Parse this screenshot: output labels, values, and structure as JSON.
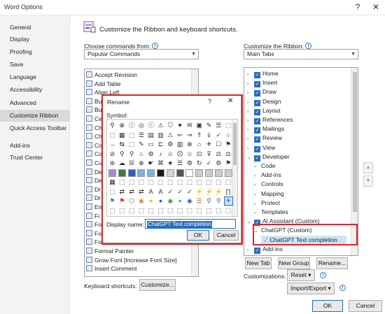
{
  "window": {
    "title": "Word Options",
    "help": "?",
    "close": "✕"
  },
  "nav": {
    "items": [
      {
        "label": "General"
      },
      {
        "label": "Display"
      },
      {
        "label": "Proofing"
      },
      {
        "label": "Save"
      },
      {
        "label": "Language"
      },
      {
        "label": "Accessibility"
      },
      {
        "label": "Advanced"
      },
      {
        "label": "Customize Ribbon"
      },
      {
        "label": "Quick Access Toolbar"
      },
      {
        "label": "Add-ins"
      },
      {
        "label": "Trust Center"
      }
    ],
    "active_index": 7
  },
  "main": {
    "header": "Customize the Ribbon and keyboard shortcuts.",
    "choose_label": "Choose commands from:",
    "choose_value": "Popular Commands",
    "customize_label": "Customize the Ribbon:",
    "customize_value": "Main Tabs",
    "commands": [
      "Accept Revision",
      "Add Table",
      "Align Left",
      "Bu",
      "Bu",
      "Ce",
      "Ch",
      "Ch",
      "Co",
      "Co",
      "Cu",
      "De",
      "De",
      "Dr",
      "Dr",
      "Em",
      "Fi",
      "Fo",
      "Fo",
      "Fo",
      "Format Painter",
      "Grow Font [Increase Font Size]",
      "Insert Comment"
    ],
    "tree": [
      {
        "label": "Home",
        "level": 0,
        "expander": "›",
        "checked": true
      },
      {
        "label": "Insert",
        "level": 0,
        "expander": "›",
        "checked": true
      },
      {
        "label": "Draw",
        "level": 0,
        "expander": "›",
        "checked": true
      },
      {
        "label": "Design",
        "level": 0,
        "expander": "›",
        "checked": true
      },
      {
        "label": "Layout",
        "level": 0,
        "expander": "›",
        "checked": true
      },
      {
        "label": "References",
        "level": 0,
        "expander": "›",
        "checked": true
      },
      {
        "label": "Mailings",
        "level": 0,
        "expander": "›",
        "checked": true
      },
      {
        "label": "Review",
        "level": 0,
        "expander": "›",
        "checked": true
      },
      {
        "label": "View",
        "level": 0,
        "expander": "›",
        "checked": true
      },
      {
        "label": "Developer",
        "level": 0,
        "expander": "⌄",
        "checked": true
      },
      {
        "label": "Code",
        "level": 1,
        "expander": "›",
        "checked": false
      },
      {
        "label": "Add-ins",
        "level": 1,
        "expander": "›",
        "checked": false
      },
      {
        "label": "Controls",
        "level": 1,
        "expander": "›",
        "checked": false
      },
      {
        "label": "Mapping",
        "level": 1,
        "expander": "›",
        "checked": false
      },
      {
        "label": "Protect",
        "level": 1,
        "expander": "›",
        "checked": false
      },
      {
        "label": "Templates",
        "level": 1,
        "expander": "›",
        "checked": false
      },
      {
        "label": "AI Assistant (Custom)",
        "level": 0,
        "expander": "⌄",
        "checked": true
      },
      {
        "label": "ChatGPT (Custom)",
        "level": 1,
        "expander": "⌄",
        "checked": false
      },
      {
        "label": "ChatGPT Text completion",
        "level": 2,
        "expander": "",
        "checked": false
      },
      {
        "label": "Add-ins",
        "level": 0,
        "expander": "›",
        "checked": true
      }
    ],
    "buttons": {
      "new_tab": "New Tab",
      "new_group": "New Group",
      "rename": "Rename...",
      "customizations_label": "Customizations:",
      "reset": "Reset ▾",
      "import_export": "Import/Export ▾",
      "keyboard_label": "Keyboard shortcuts:",
      "customize": "Customize...",
      "ok": "OK",
      "cancel": "Cancel"
    }
  },
  "dialog": {
    "title": "Rename",
    "help": "?",
    "close": "✕",
    "symbol_label": "Symbol:",
    "display_name_label": "Display name:",
    "display_name_value": "ChatGPT Text completion",
    "ok": "OK",
    "cancel": "Cancel",
    "symbols": [
      "⚲",
      "⊗",
      "ⓘ",
      "◎",
      "ⓘ",
      "⚠",
      "⛉",
      "♥",
      "✉",
      "▣",
      "✎",
      "☰",
      "⬚",
      "⬚",
      "▦",
      "⬚",
      "☰",
      "▤",
      "▥",
      "⚠",
      "⇐",
      "⇒",
      "⇑",
      "⇓",
      "✓",
      "○",
      "→",
      "⇆",
      "⬚",
      "✎",
      "▭",
      "⊏",
      "⚙",
      "▥",
      "⊕",
      "⌂",
      "✈",
      "☐",
      "⚑",
      "⊘",
      "⚲",
      "⚲",
      "⌂",
      "⚙",
      "♪",
      "☺",
      "☹",
      "☺",
      "⊡",
      "⊽",
      "⚖",
      "⚖",
      "⊛",
      "☁",
      "☒",
      "⊕",
      "☛",
      "⌘",
      "★",
      "☰",
      "⚙",
      "↻",
      "✓",
      "⚙",
      "⚑",
      "■",
      "■",
      "■",
      "■",
      "■",
      "■",
      "■",
      "■",
      "■",
      "■",
      "■",
      "■",
      "■",
      "▦",
      "⬚",
      "⬚",
      "⬚",
      "⬚",
      "⬚",
      "⬚",
      "⬚",
      "⬚",
      "⬚",
      "⬚",
      "⬚",
      "⬚",
      "⬚",
      "⇄",
      "⇄",
      "⇄",
      "A",
      "A",
      "✓",
      "✓",
      "✓",
      "⚡",
      "⚡",
      "⚡",
      "∏",
      "⚑",
      "⚑",
      "⬡",
      "◉",
      "●",
      "●",
      "◉",
      "●",
      "◉",
      "☰",
      "⚲",
      "⚲",
      "✈",
      "⬚",
      "⬚",
      "⬚",
      "⬚",
      "⬚",
      "⬚",
      "⬚",
      "⬚",
      "⬚",
      "⬚",
      "⬚",
      "⬚",
      "⬚"
    ],
    "symbol_colors": {
      "row5": [
        "#a98bd0",
        "#3a7d3a",
        "#2b62c0",
        "#7fb0e0",
        "#76b6e6",
        "#1a1a1a",
        "#d3d3d3",
        "#555555",
        "#ffffff",
        "#cccccc",
        "#cccccc",
        "#cccccc",
        "#cccccc"
      ],
      "row8": [
        "#3c78c8",
        "#d9262c",
        "#3d8a3d",
        "#e08a24",
        "#f2c200",
        "#1f5fb0",
        "#3a9a3a",
        "#6d9ed4",
        "#2b62c0",
        "#e06d1a",
        "#555555",
        "#555555",
        "#2b62c0"
      ]
    }
  },
  "colors": {
    "accent": "#2a6ebb",
    "highlight_red": "#d9262c",
    "selection": "#cce4f7",
    "nav_active": "#d9d9d9"
  }
}
